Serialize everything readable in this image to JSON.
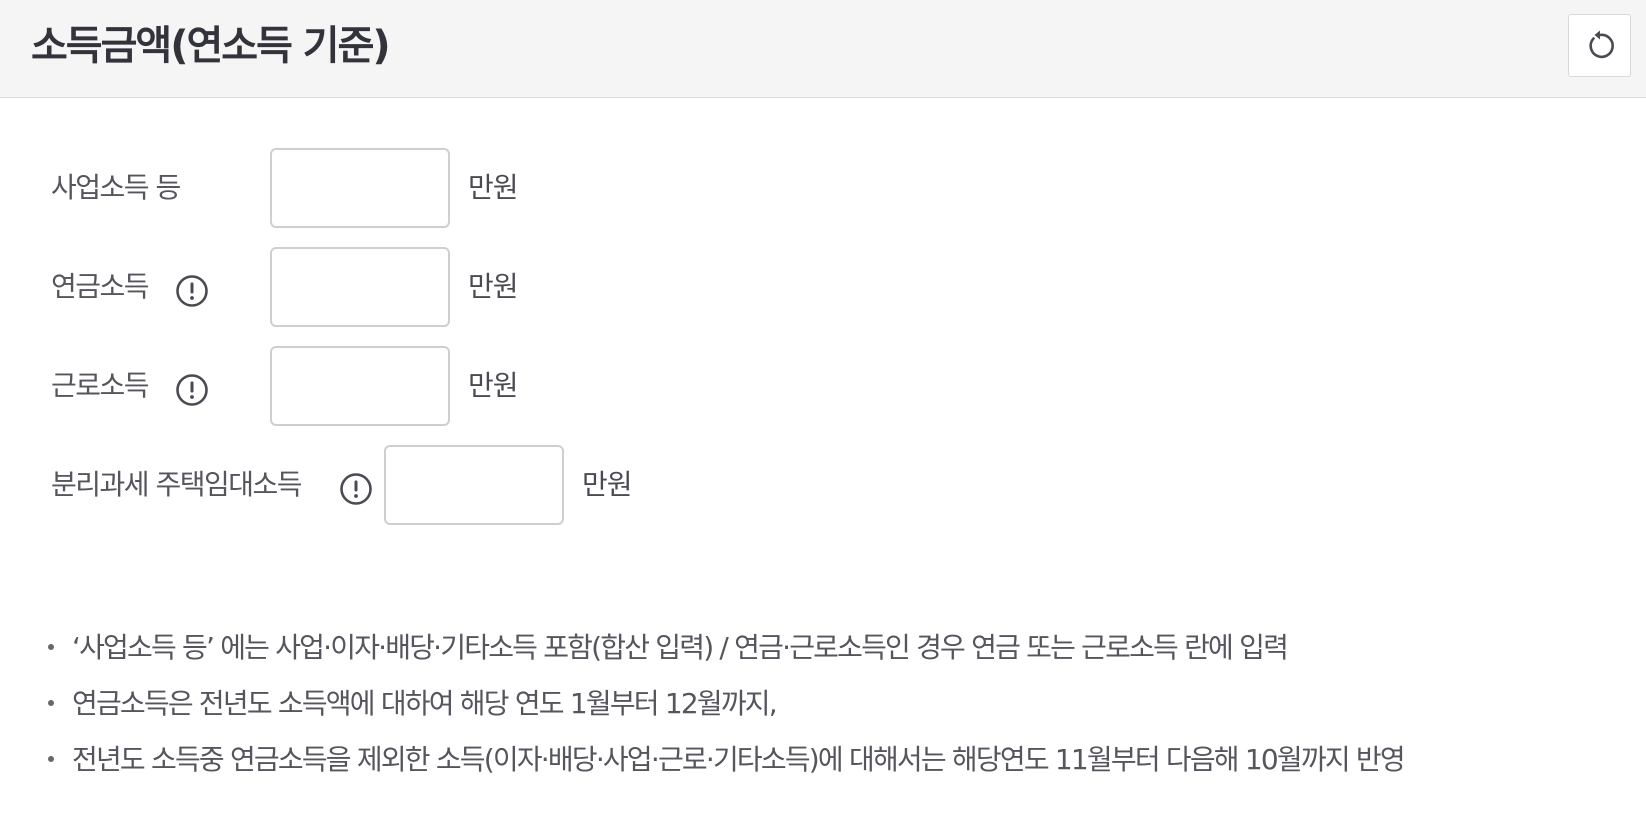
{
  "header": {
    "title": "소득금액(연소득 기준)",
    "reset_icon": "reset-icon"
  },
  "form": {
    "unit": "만원",
    "fields": [
      {
        "label": "사업소득 등",
        "value": "",
        "has_info": false
      },
      {
        "label": "연금소득",
        "value": "",
        "has_info": true,
        "icon": "info-icon"
      },
      {
        "label": "근로소득",
        "value": "",
        "has_info": true,
        "icon": "info-icon"
      },
      {
        "label": "분리과세 주택임대소득",
        "value": "",
        "has_info": true,
        "icon": "info-icon"
      }
    ]
  },
  "notes": [
    "‘사업소득 등’ 에는 사업·이자·배당·기타소득 포함(합산 입력) / 연금·근로소득인 경우 연금 또는 근로소득 란에 입력",
    "연금소득은 전년도 소득액에 대하여 해당 연도 1월부터 12월까지,",
    "전년도 소득중 연금소득을 제외한 소득(이자·배당·사업·근로·기타소득)에 대해서는 해당연도 11월부터 다음해 10월까지 반영"
  ],
  "colors": {
    "header_bg": "#f5f5f5",
    "title": "#33333b",
    "text": "#55555d",
    "input_border": "#cfcfcf"
  }
}
